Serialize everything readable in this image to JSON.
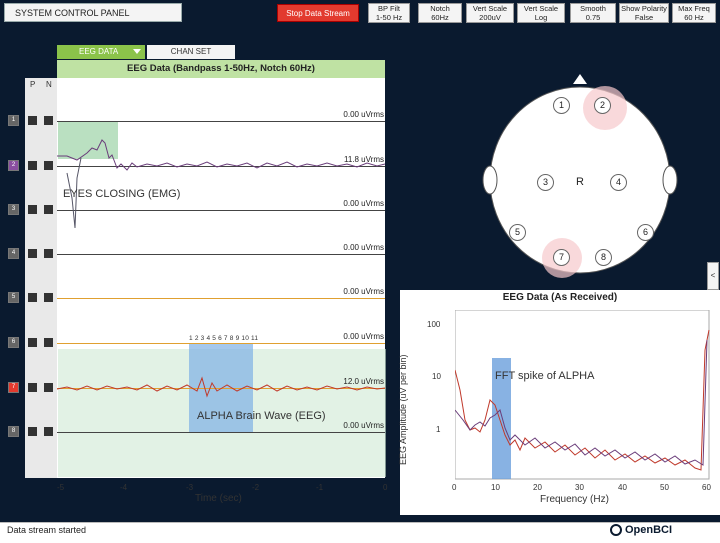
{
  "topbar": {
    "system_panel": "SYSTEM CONTROL PANEL",
    "stop_stream": "Stop Data Stream",
    "controls": [
      {
        "label": "BP Filt",
        "value": "1-50 Hz"
      },
      {
        "label": "Notch",
        "value": "60Hz"
      },
      {
        "label": "Vert Scale",
        "value": "200uV"
      },
      {
        "label": "Vert Scale",
        "value": "Log"
      },
      {
        "label": "Smooth",
        "value": "0.75"
      },
      {
        "label": "Show Polarity",
        "value": "False"
      },
      {
        "label": "Max Freq",
        "value": "60 Hz"
      }
    ]
  },
  "eeg": {
    "tab_eeg": "EEG DATA",
    "tab_chan": "CHAN SET",
    "header": "EEG Data (Bandpass 1-50Hz, Notch 60Hz)",
    "col_p": "P",
    "col_n": "N",
    "channels": [
      "1",
      "2",
      "3",
      "4",
      "5",
      "6",
      "7",
      "8"
    ],
    "vrms": [
      "0.00 uVrms",
      "11.8 uVrms",
      "0.00 uVrms",
      "0.00 uVrms",
      "0.00 uVrms",
      "0.00 uVrms",
      "12.0 uVrms",
      "0.00 uVrms"
    ],
    "x_ticks": [
      "-5",
      "-4",
      "-3",
      "-2",
      "-1",
      "0"
    ],
    "x_label": "Time (sec)",
    "annotation_eyes": "EYES CLOSING (EMG)",
    "annotation_alpha": "ALPHA Brain Wave (EEG)",
    "alpha_numbers": "1 2 3 4 5 6 7 8 9 10 11"
  },
  "head": {
    "electrodes": [
      "1",
      "2",
      "3",
      "4",
      "5",
      "6",
      "7",
      "8"
    ],
    "ref": "R"
  },
  "fft": {
    "title": "EEG Data (As Received)",
    "y_label": "EEG Amplitude (uV per bin)",
    "x_label": "Frequency (Hz)",
    "y_ticks": [
      "100",
      "10",
      "1"
    ],
    "x_ticks": [
      "0",
      "10",
      "20",
      "30",
      "40",
      "50",
      "60"
    ],
    "annotation": "FFT spike of ALPHA"
  },
  "footer": {
    "status": "Data stream started",
    "logo": "OpenBCI"
  },
  "colors": {
    "bg": "#0a1a2f",
    "accent_green": "#8bc34a",
    "stop_red": "#e23a2e",
    "trace_ch2": "#6a3d7a",
    "trace_ch7": "#c0392b"
  }
}
